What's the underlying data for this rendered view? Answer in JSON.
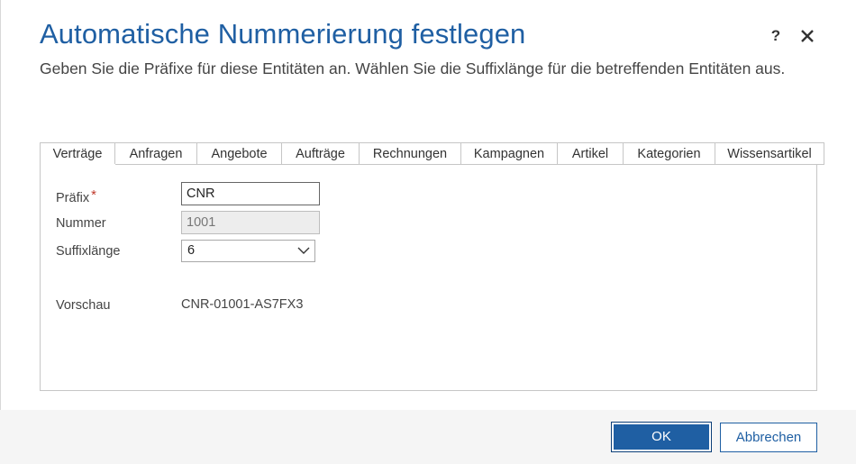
{
  "dialog": {
    "title": "Automatische Nummerierung festlegen",
    "subtitle": "Geben Sie die Präfixe für diese Entitäten an. Wählen Sie die Suffixlänge für die betreffenden Entitäten aus.",
    "help_glyph": "?",
    "close_glyph": "✕"
  },
  "tabs": [
    {
      "label": "Verträge",
      "active": true
    },
    {
      "label": "Anfragen"
    },
    {
      "label": "Angebote"
    },
    {
      "label": "Aufträge"
    },
    {
      "label": "Rechnungen"
    },
    {
      "label": "Kampagnen"
    },
    {
      "label": "Artikel"
    },
    {
      "label": "Kategorien"
    },
    {
      "label": "Wissensartikel"
    }
  ],
  "form": {
    "prefix_label": "Präfix",
    "required_mark": "*",
    "prefix_value": "CNR",
    "number_label": "Nummer",
    "number_value": "1001",
    "suffix_label": "Suffixlänge",
    "suffix_value": "6",
    "preview_label": "Vorschau",
    "preview_value": "CNR-01001-AS7FX3"
  },
  "buttons": {
    "ok": "OK",
    "cancel": "Abbrechen"
  },
  "colors": {
    "accent": "#1f5fa3",
    "required": "#c0392b"
  }
}
